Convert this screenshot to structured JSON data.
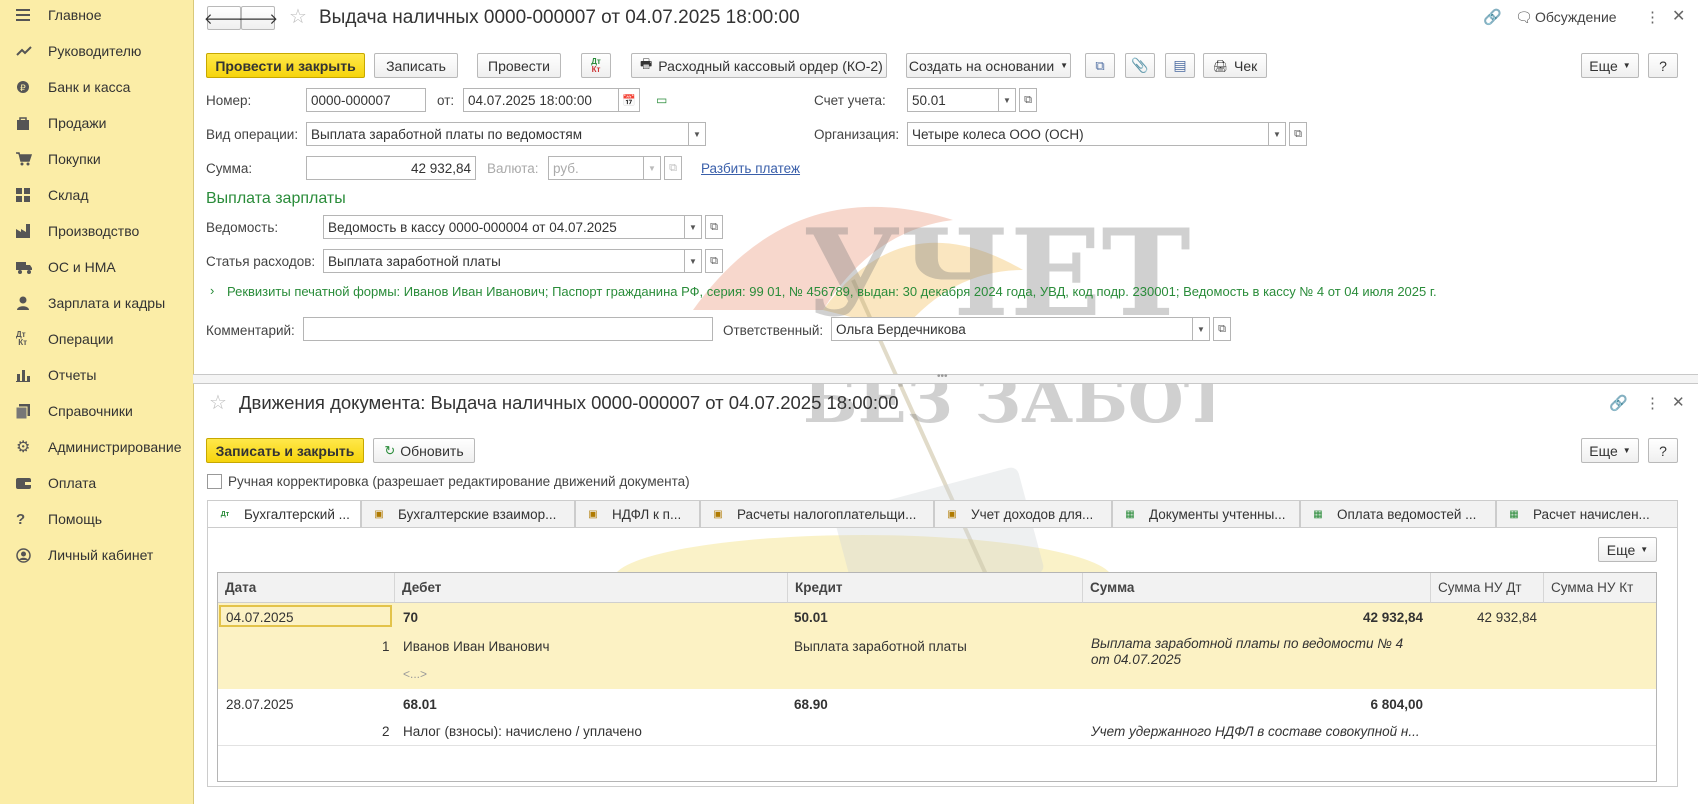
{
  "sidebar": {
    "items": [
      {
        "label": "Главное",
        "icon": "menu-icon"
      },
      {
        "label": "Руководителю",
        "icon": "trend-icon"
      },
      {
        "label": "Банк и касса",
        "icon": "coin-icon"
      },
      {
        "label": "Продажи",
        "icon": "bag-icon"
      },
      {
        "label": "Покупки",
        "icon": "cart-icon"
      },
      {
        "label": "Склад",
        "icon": "warehouse-icon"
      },
      {
        "label": "Производство",
        "icon": "factory-icon"
      },
      {
        "label": "ОС и НМА",
        "icon": "truck-icon"
      },
      {
        "label": "Зарплата и кадры",
        "icon": "person-icon"
      },
      {
        "label": "Операции",
        "icon": "dt-kt-icon"
      },
      {
        "label": "Отчеты",
        "icon": "bar-chart-icon"
      },
      {
        "label": "Справочники",
        "icon": "books-icon"
      },
      {
        "label": "Администрирование",
        "icon": "gear-icon"
      },
      {
        "label": "Оплата",
        "icon": "wallet-icon"
      },
      {
        "label": "Помощь",
        "icon": "question-icon"
      },
      {
        "label": "Личный кабинет",
        "icon": "account-icon"
      }
    ]
  },
  "doc": {
    "title": "Выдача наличных 0000-000007 от 04.07.2025 18:00:00",
    "discussion": "Обсуждение",
    "toolbar": {
      "post_close": "Провести и закрыть",
      "save": "Записать",
      "post": "Провести",
      "dtkt": "Дт Кт",
      "print_order": "Расходный кассовый ордер (КО-2)",
      "create_based": "Создать на основании",
      "check": "Чек",
      "more": "Еще",
      "help": "?"
    },
    "number_label": "Номер:",
    "number": "0000-000007",
    "from_label": "от:",
    "date": "04.07.2025 18:00:00",
    "account_label": "Счет учета:",
    "account": "50.01",
    "operation_label": "Вид операции:",
    "operation": "Выплата заработной платы по ведомостям",
    "org_label": "Организация:",
    "org": "Четыре колеса ООО (ОСН)",
    "sum_label": "Сумма:",
    "sum": "42 932,84",
    "currency_label": "Валюта:",
    "currency": "руб.",
    "split_link": "Разбить платеж",
    "section_title": "Выплата зарплаты",
    "statement_label": "Ведомость:",
    "statement": "Ведомость в кассу 0000-000004 от 04.07.2025",
    "expense_label": "Статья расходов:",
    "expense": "Выплата заработной платы",
    "print_details": "Реквизиты печатной формы: Иванов Иван Иванович; Паспорт гражданина РФ, серия: 99 01, № 456789, выдан: 30 декабря 2024 года, УВД, код подр. 230001; Ведомость в кассу № 4 от 04 июля 2025 г.",
    "comment_label": "Комментарий:",
    "comment": "",
    "responsible_label": "Ответственный:",
    "responsible": "Ольга Бердечникова"
  },
  "movements": {
    "title": "Движения документа: Выдача наличных 0000-000007 от 04.07.2025 18:00:00",
    "save_close": "Записать и закрыть",
    "refresh": "Обновить",
    "more": "Еще",
    "help": "?",
    "manual_label": "Ручная корректировка (разрешает редактирование движений документа)",
    "tabs": [
      "Бухгалтерский ...",
      "Бухгалтерские взаимор...",
      "НДФЛ к п...",
      "Расчеты налогоплательщи...",
      "Учет доходов для...",
      "Документы учтенны...",
      "Оплата ведомостей ...",
      "Расчет начислен..."
    ],
    "grid_more": "Еще",
    "columns": [
      "Дата",
      "Дебет",
      "Кредит",
      "Сумма",
      "Сумма НУ Дт",
      "Сумма НУ Кт"
    ],
    "rows": [
      {
        "date": "04.07.2025",
        "num": "1",
        "debit": "70",
        "debit_sub": "Иванов Иван Иванович",
        "debit_sub2": "<...>",
        "credit": "50.01",
        "credit_sub": "Выплата заработной платы",
        "sum": "42 932,84",
        "content": "Выплата заработной платы по ведомости № 4 от 04.07.2025",
        "nu_dt": "42 932,84",
        "nu_kt": ""
      },
      {
        "date": "28.07.2025",
        "num": "2",
        "debit": "68.01",
        "debit_sub": "Налог (взносы): начислено / уплачено",
        "debit_sub2": "",
        "credit": "68.90",
        "credit_sub": "",
        "sum": "6 804,00",
        "content": "Учет удержанного НДФЛ в составе совокупной н...",
        "nu_dt": "",
        "nu_kt": ""
      }
    ]
  },
  "watermark": {
    "line1": "УЧЕТ",
    "line2": "БЕЗ ЗАБОТ"
  },
  "colors": {
    "sidebar": "#fbeda7",
    "accent_button": "#f6d40c",
    "section_green": "#2a8c3a",
    "selected_row": "#fcf2c4"
  }
}
